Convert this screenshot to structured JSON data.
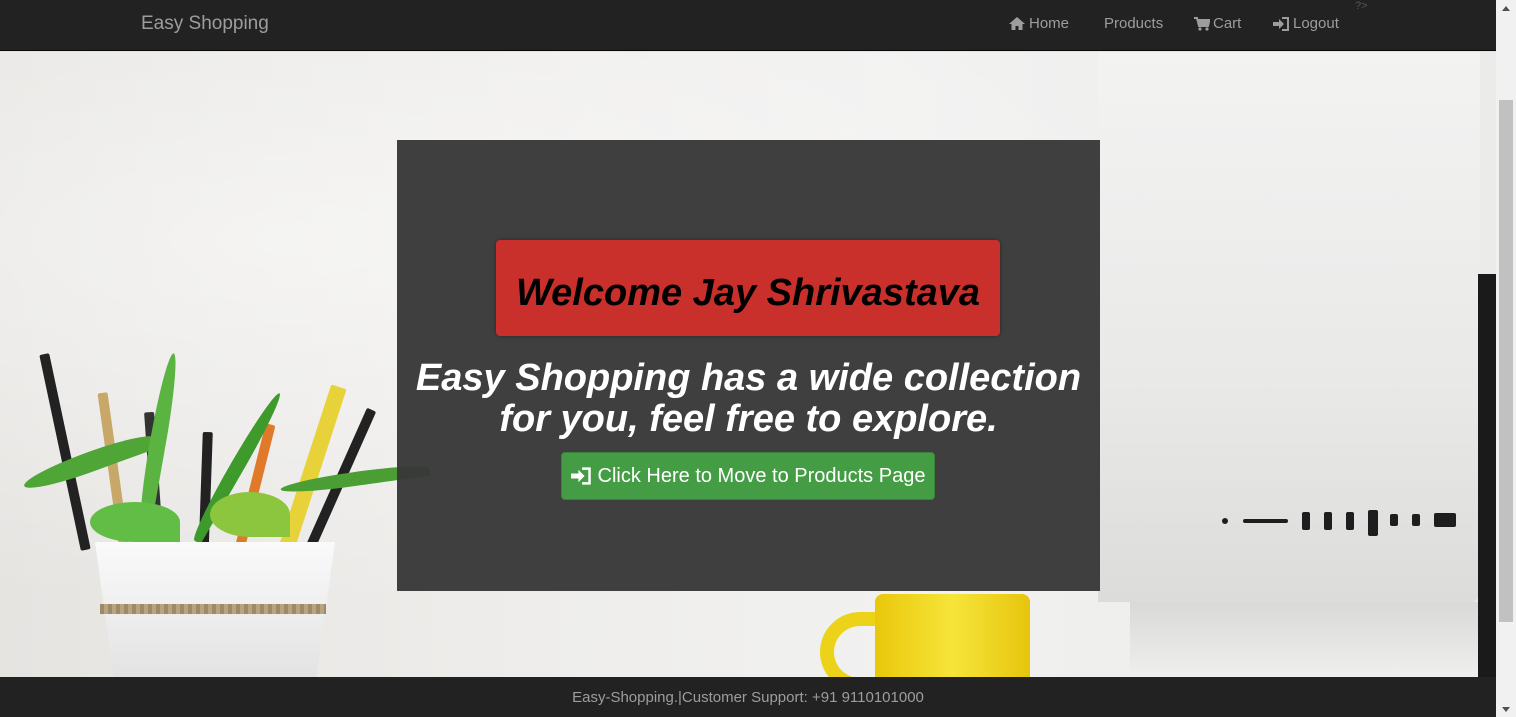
{
  "navbar": {
    "brand": "Easy Shopping",
    "items": [
      {
        "label": "Home",
        "icon": "home-icon"
      },
      {
        "label": "Products"
      },
      {
        "label": "Cart",
        "icon": "cart-icon"
      },
      {
        "label": "Logout",
        "icon": "log-in-icon"
      }
    ],
    "stray_text": "?>"
  },
  "hero": {
    "welcome": "Welcome Jay Shrivastava",
    "tagline_line1": "Easy Shopping has a wide collection",
    "tagline_line2": "for you, feel free to explore.",
    "button_label": "Click Here to Move to Products Page",
    "button_icon": "log-in-icon"
  },
  "footer": {
    "text": "Easy-Shopping.|Customer Support: +91 9110101000"
  },
  "colors": {
    "navbar_bg": "#222222",
    "nav_text": "#9d9d9d",
    "welcome_red": "#c9302c",
    "button_green": "#449d44",
    "card_bg": "#3a3a3a"
  }
}
